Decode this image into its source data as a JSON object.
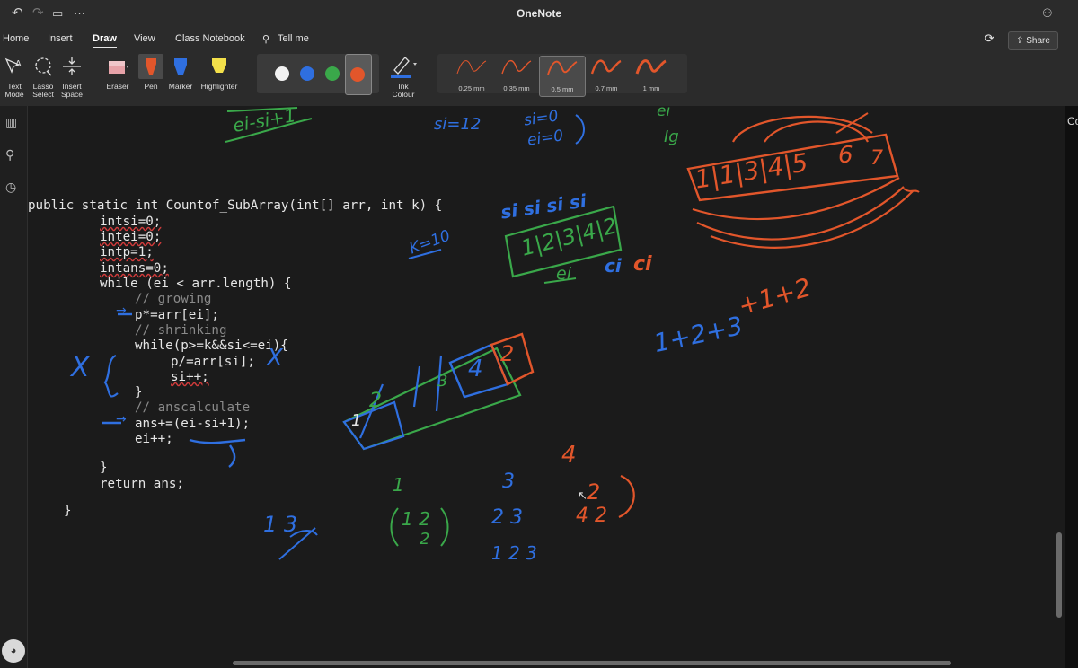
{
  "window": {
    "title": "OneNote"
  },
  "menu": {
    "tabs": [
      "Home",
      "Insert",
      "Draw",
      "View",
      "Class Notebook",
      "Tell me"
    ],
    "active": "Draw",
    "share": "Share"
  },
  "ribbon": {
    "tools": [
      {
        "line1": "Text",
        "line2": "Mode"
      },
      {
        "line1": "Lasso",
        "line2": "Select"
      },
      {
        "line1": "Insert",
        "line2": "Space"
      },
      {
        "line1": "Eraser",
        "line2": ""
      },
      {
        "line1": "Pen",
        "line2": ""
      },
      {
        "line1": "Marker",
        "line2": ""
      },
      {
        "line1": "Highlighter",
        "line2": ""
      },
      {
        "line1": "Ink",
        "line2": "Colour"
      }
    ],
    "colors": [
      "#f2f2f2",
      "#2f6fe0",
      "#3aa84a",
      "#e2562b"
    ],
    "selected_color": "#e2562b",
    "thickness": [
      "0.25 mm",
      "0.35 mm",
      "0.5 mm",
      "0.7 mm",
      "1 mm"
    ],
    "selected_thickness": "0.5 mm"
  },
  "code": {
    "line1": "public static int Countof_SubArray(int[] arr, int k) {",
    "line2": "intsi=0;",
    "line3": "intei=0;",
    "line4": "intp=1;",
    "line5": "intans=0;",
    "line6": "while (ei < arr.length) {",
    "line7": "// growing",
    "line8": "p*=arr[ei];",
    "line9": "// shrinking",
    "line10": "while(p>=k&&si<=ei){",
    "line11": "p/=arr[si];",
    "line12": "si++;",
    "line13": "}",
    "line14": "// anscalculate",
    "line15": "ans+=(ei-si+1);",
    "line16": "ei++;",
    "line17": "}",
    "line18": "return ans;",
    "line19": "}"
  },
  "ink": {
    "top_green": "ei-si+1",
    "si_eq": "si=12",
    "si_ei_a": "si=0",
    "si_ei_b": "ei=0",
    "ei_top": "ei",
    "ig": "Ig",
    "k_eq": "K=10",
    "si_labels": "si si si si",
    "green_array": "1|2|3|4|2",
    "ei_label": "ei",
    "ci_blue": "ci",
    "ci_red": "ci",
    "orange_array": "1|1|3|4|5",
    "orange_6": "6",
    "orange_7": "7",
    "sum_blue": "1+2+3",
    "sum_orange": "+1+2",
    "x_mark": "X",
    "arrow1": "→",
    "arrow2": "→",
    "mid_1": "1",
    "mid_2": "2",
    "mid_3": "3",
    "mid_4": "4",
    "mid_2r": "2",
    "n_1": "1",
    "n_12": "1 2",
    "n_2": "2",
    "n_3": "3",
    "n_23": "2 3",
    "n_123": "1 2 3",
    "o_4": "4",
    "o_2": "2",
    "o_42": "4 2",
    "cross": "1 3"
  }
}
